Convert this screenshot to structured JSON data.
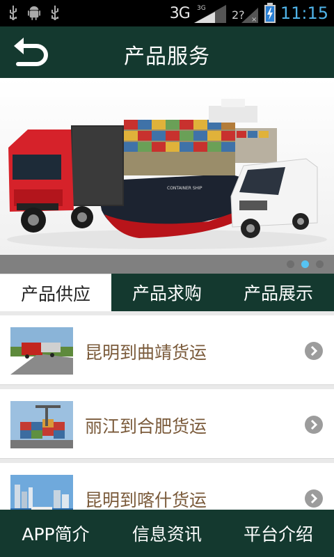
{
  "status_bar": {
    "network": "3G",
    "network_small": "3G",
    "time": "11:15",
    "icons": [
      "usb-icon",
      "android-debug-icon",
      "usb-icon",
      "signal-icon",
      "no-sim-icon",
      "battery-charging-icon"
    ]
  },
  "header": {
    "title": "产品服务",
    "back_icon": "back-arrow-icon"
  },
  "banner": {
    "slides": 3,
    "active_slide": 2
  },
  "tabs": [
    {
      "label": "产品供应",
      "active": true
    },
    {
      "label": "产品求购",
      "active": false
    },
    {
      "label": "产品展示",
      "active": false
    }
  ],
  "list": {
    "items": [
      {
        "label": "昆明到曲靖货运",
        "thumb": "truck-on-road"
      },
      {
        "label": "丽江到合肥货运",
        "thumb": "container-port"
      },
      {
        "label": "昆明到喀什货运",
        "thumb": "city-harbor"
      }
    ]
  },
  "bottom_nav": [
    {
      "label": "APP简介"
    },
    {
      "label": "信息资讯"
    },
    {
      "label": "平台介绍"
    }
  ],
  "colors": {
    "primary": "#14392f",
    "status_time": "#4fb3e8",
    "list_text": "#7a5a3a",
    "active_dot": "#56c3f2"
  }
}
